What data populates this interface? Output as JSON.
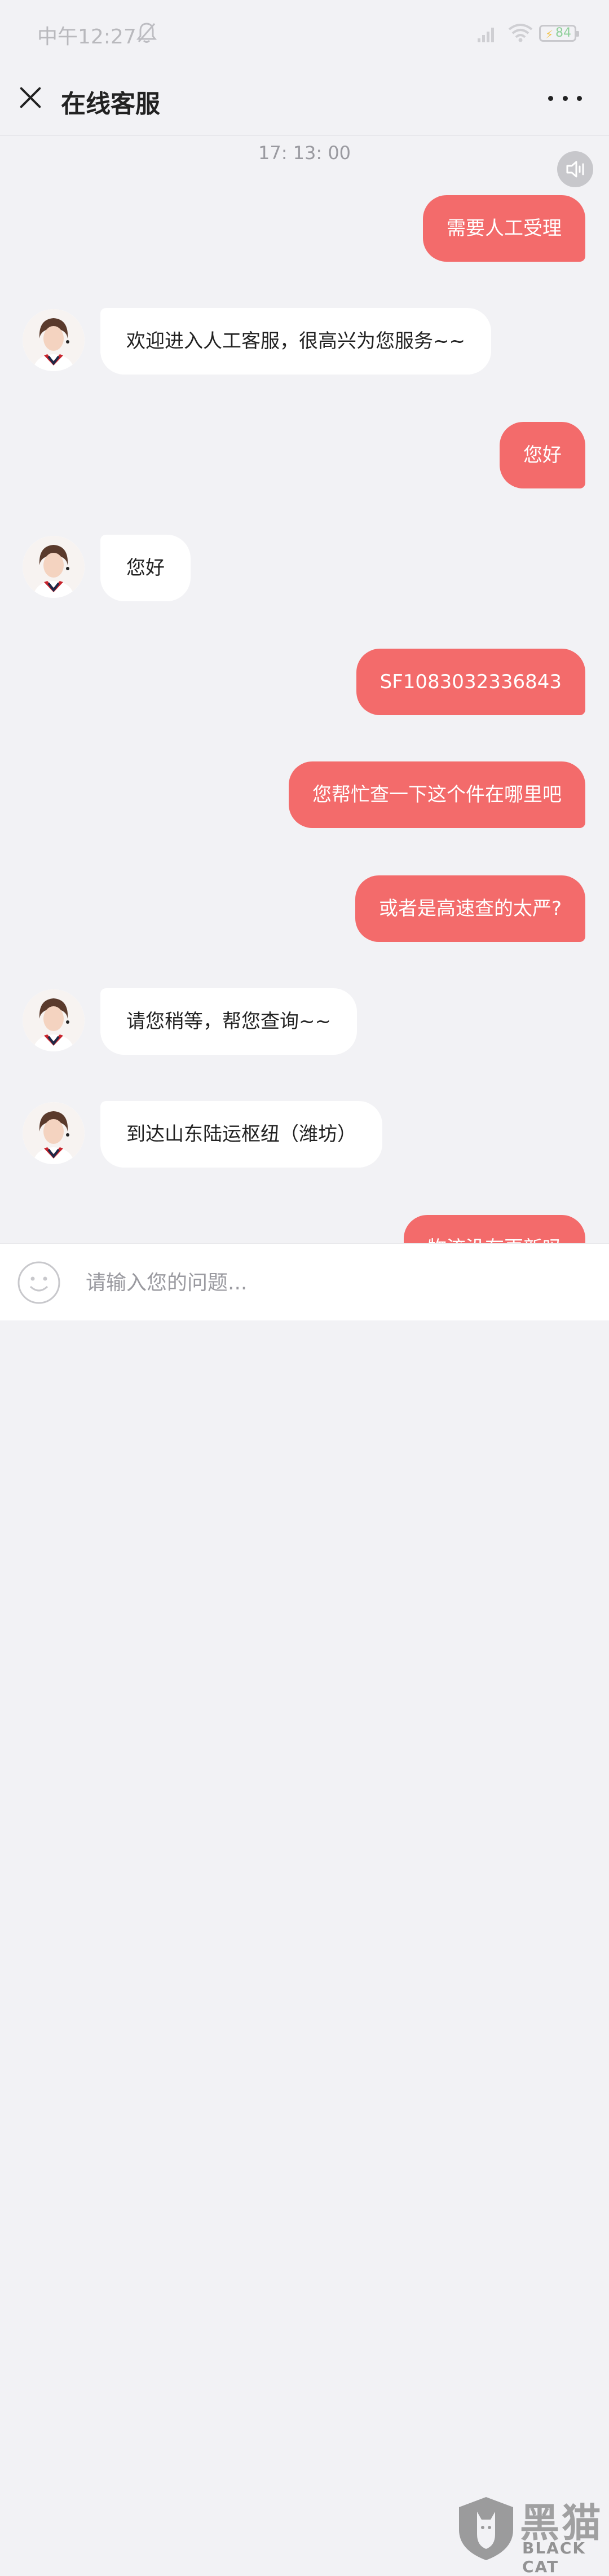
{
  "status_bar": {
    "time": "中午12:27",
    "battery": "84"
  },
  "header": {
    "title": "在线客服"
  },
  "chat": {
    "timestamp": "17: 13: 00",
    "messages": [
      {
        "side": "out",
        "text": "需要人工受理"
      },
      {
        "side": "in",
        "text": "欢迎进入人工客服，很高兴为您服务~~"
      },
      {
        "side": "out",
        "text": "您好"
      },
      {
        "side": "in",
        "text": "您好"
      },
      {
        "side": "out",
        "text": "SF1083032336843"
      },
      {
        "side": "out",
        "text": "您帮忙查一下这个件在哪里吧"
      },
      {
        "side": "out",
        "text": "或者是高速查的太严?"
      },
      {
        "side": "in",
        "text": "请您稍等，帮您查询~~"
      },
      {
        "side": "in",
        "text": "到达山东陆运枢纽（潍坊）"
      },
      {
        "side": "out",
        "text": "物流没有更新吗"
      }
    ]
  },
  "input": {
    "placeholder": "请输入您的问题..."
  },
  "watermark": {
    "cn": "黑猫",
    "en": "BLACK CAT"
  },
  "colors": {
    "outgoing_bubble": "#f36b6b",
    "incoming_bubble": "#ffffff",
    "background": "#f2f2f5"
  }
}
